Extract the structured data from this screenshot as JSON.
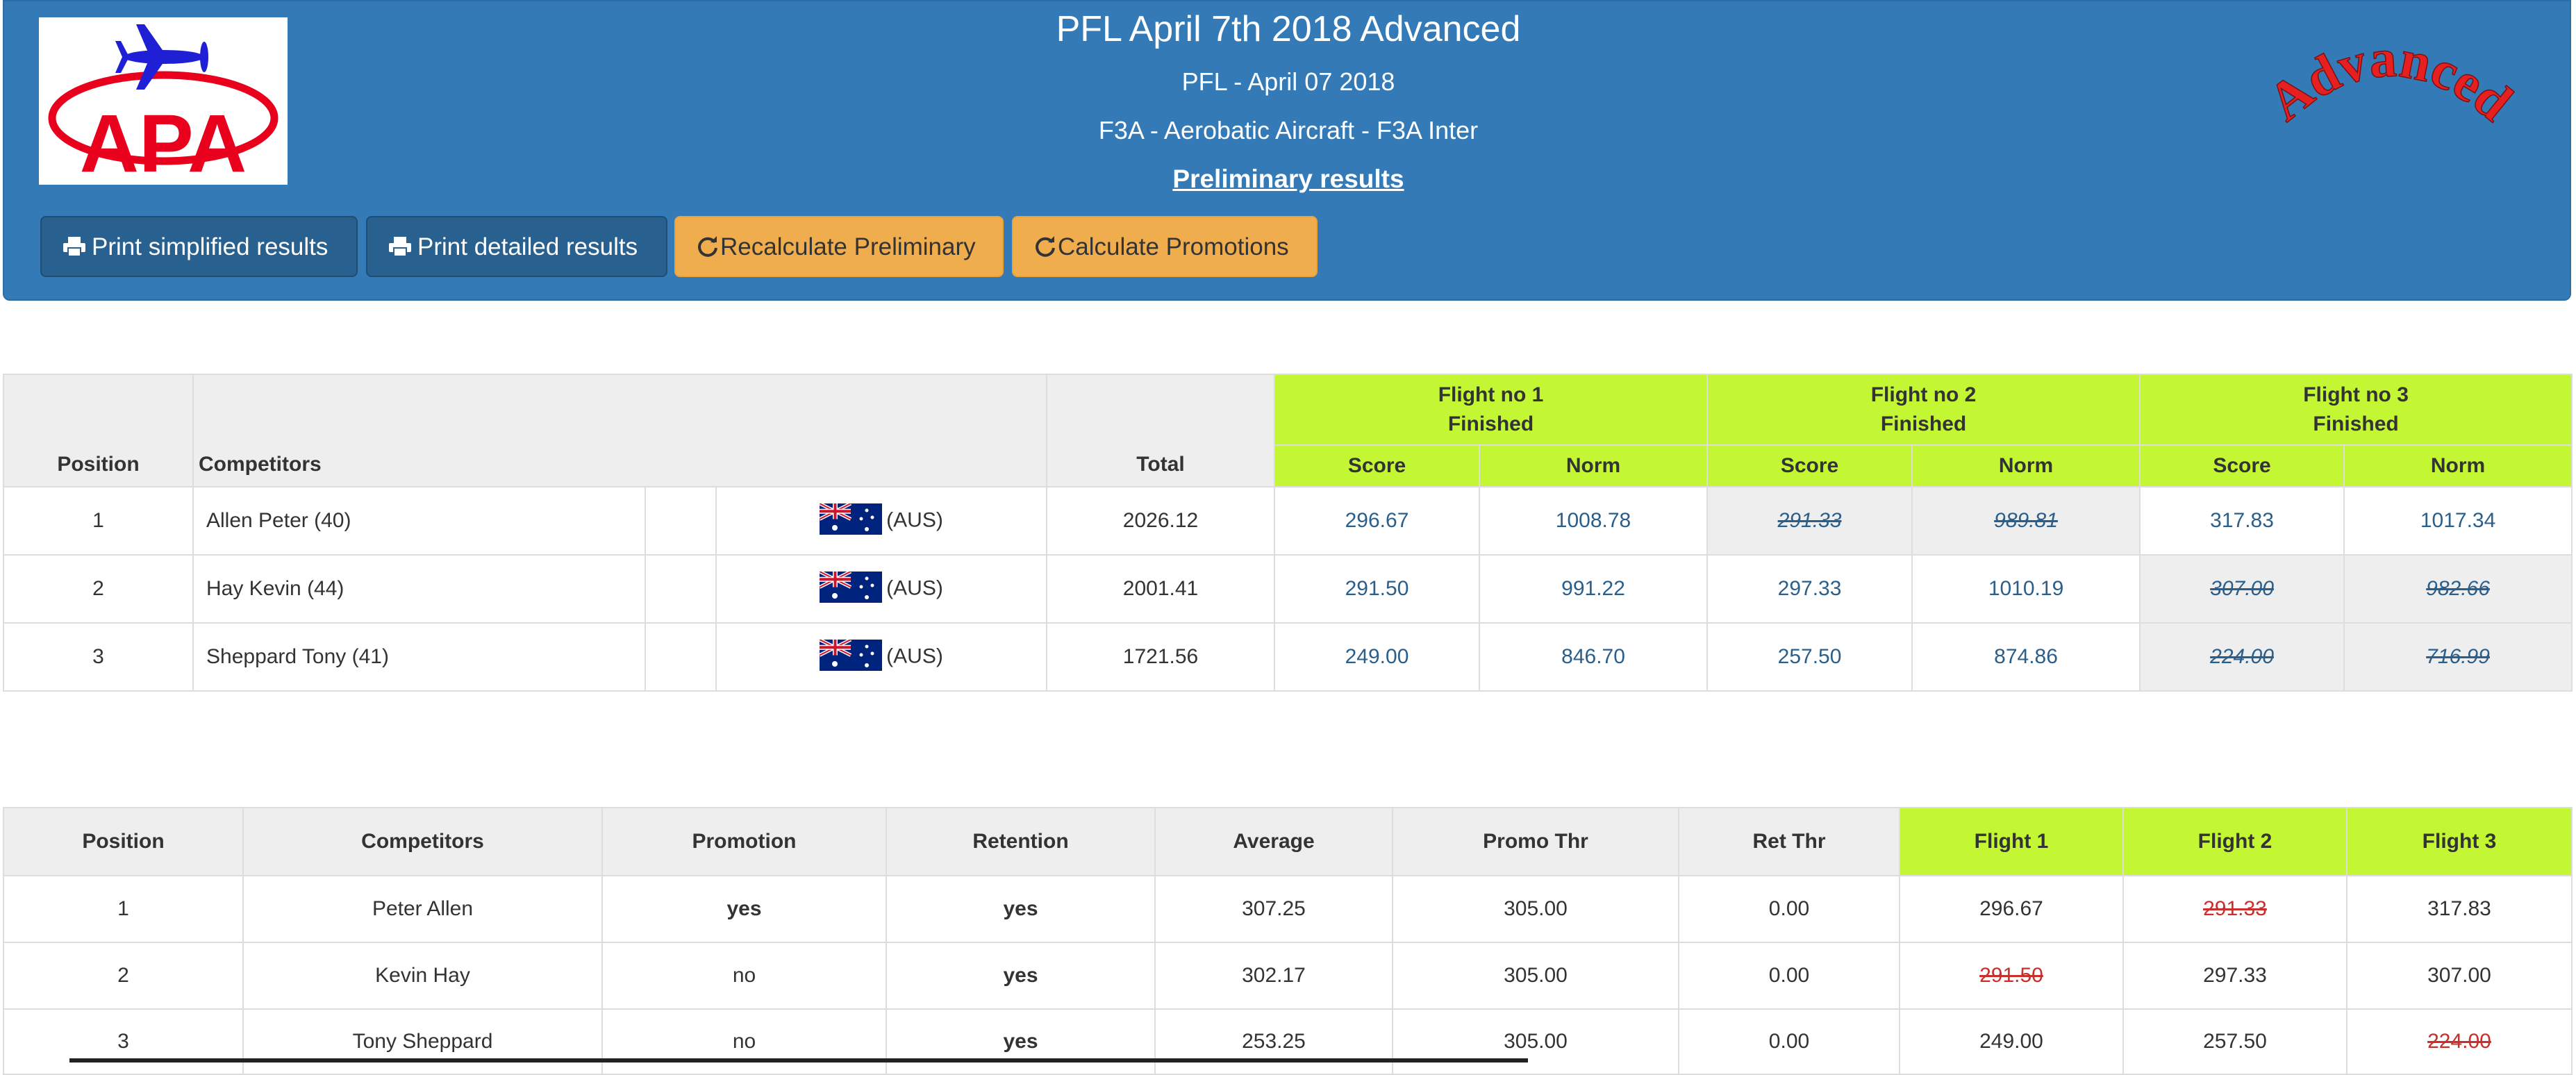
{
  "header": {
    "title": "PFL April 7th 2018 Advanced",
    "subtitle": "PFL - April 07 2018",
    "category": "F3A - Aerobatic Aircraft - F3A Inter",
    "status_link": "Preliminary results",
    "stamp_text": "Advanced",
    "logo_text": "APA"
  },
  "toolbar": {
    "print_simplified": "Print simplified results",
    "print_detailed": "Print detailed results",
    "recalculate": "Recalculate Preliminary",
    "calculate_promotions": "Calculate Promotions"
  },
  "results_table": {
    "headers": {
      "position": "Position",
      "competitors": "Competitors",
      "total": "Total",
      "score": "Score",
      "norm": "Norm"
    },
    "flights": [
      {
        "name": "Flight no 1",
        "status": "Finished"
      },
      {
        "name": "Flight no 2",
        "status": "Finished"
      },
      {
        "name": "Flight no 3",
        "status": "Finished"
      }
    ],
    "rows": [
      {
        "position": "1",
        "name": "Allen Peter (40)",
        "country": "(AUS)",
        "total": "2026.12",
        "f1_score": "296.67",
        "f1_norm": "1008.78",
        "f2_score": "291.33",
        "f2_norm": "989.81",
        "f3_score": "317.83",
        "f3_norm": "1017.34",
        "dropped": 2
      },
      {
        "position": "2",
        "name": "Hay Kevin (44)",
        "country": "(AUS)",
        "total": "2001.41",
        "f1_score": "291.50",
        "f1_norm": "991.22",
        "f2_score": "297.33",
        "f2_norm": "1010.19",
        "f3_score": "307.00",
        "f3_norm": "982.66",
        "dropped": 3
      },
      {
        "position": "3",
        "name": "Sheppard Tony (41)",
        "country": "(AUS)",
        "total": "1721.56",
        "f1_score": "249.00",
        "f1_norm": "846.70",
        "f2_score": "257.50",
        "f2_norm": "874.86",
        "f3_score": "224.00",
        "f3_norm": "716.99",
        "dropped": 3
      }
    ]
  },
  "promotion_table": {
    "headers": {
      "position": "Position",
      "competitors": "Competitors",
      "promotion": "Promotion",
      "retention": "Retention",
      "average": "Average",
      "promo_thr": "Promo Thr",
      "ret_thr": "Ret Thr",
      "flight1": "Flight 1",
      "flight2": "Flight 2",
      "flight3": "Flight 3"
    },
    "rows": [
      {
        "position": "1",
        "name": "Peter Allen",
        "promotion": "yes",
        "retention": "yes",
        "average": "307.25",
        "promo_thr": "305.00",
        "ret_thr": "0.00",
        "flight1": "296.67",
        "flight2": "291.33",
        "flight3": "317.83"
      },
      {
        "position": "2",
        "name": "Kevin Hay",
        "promotion": "no",
        "retention": "yes",
        "average": "302.17",
        "promo_thr": "305.00",
        "ret_thr": "0.00",
        "flight1": "291.50",
        "flight2": "297.33",
        "flight3": "307.00"
      },
      {
        "position": "3",
        "name": "Tony Sheppard",
        "promotion": "no",
        "retention": "yes",
        "average": "253.25",
        "promo_thr": "305.00",
        "ret_thr": "0.00",
        "flight1": "249.00",
        "flight2": "257.50",
        "flight3": "224.00"
      }
    ]
  },
  "colors": {
    "banner": "#337ab7",
    "flight_header": "#c3f733",
    "warning_button": "#f0ad4e",
    "dark_button": "#286090",
    "strike_red": "#c9302c"
  }
}
